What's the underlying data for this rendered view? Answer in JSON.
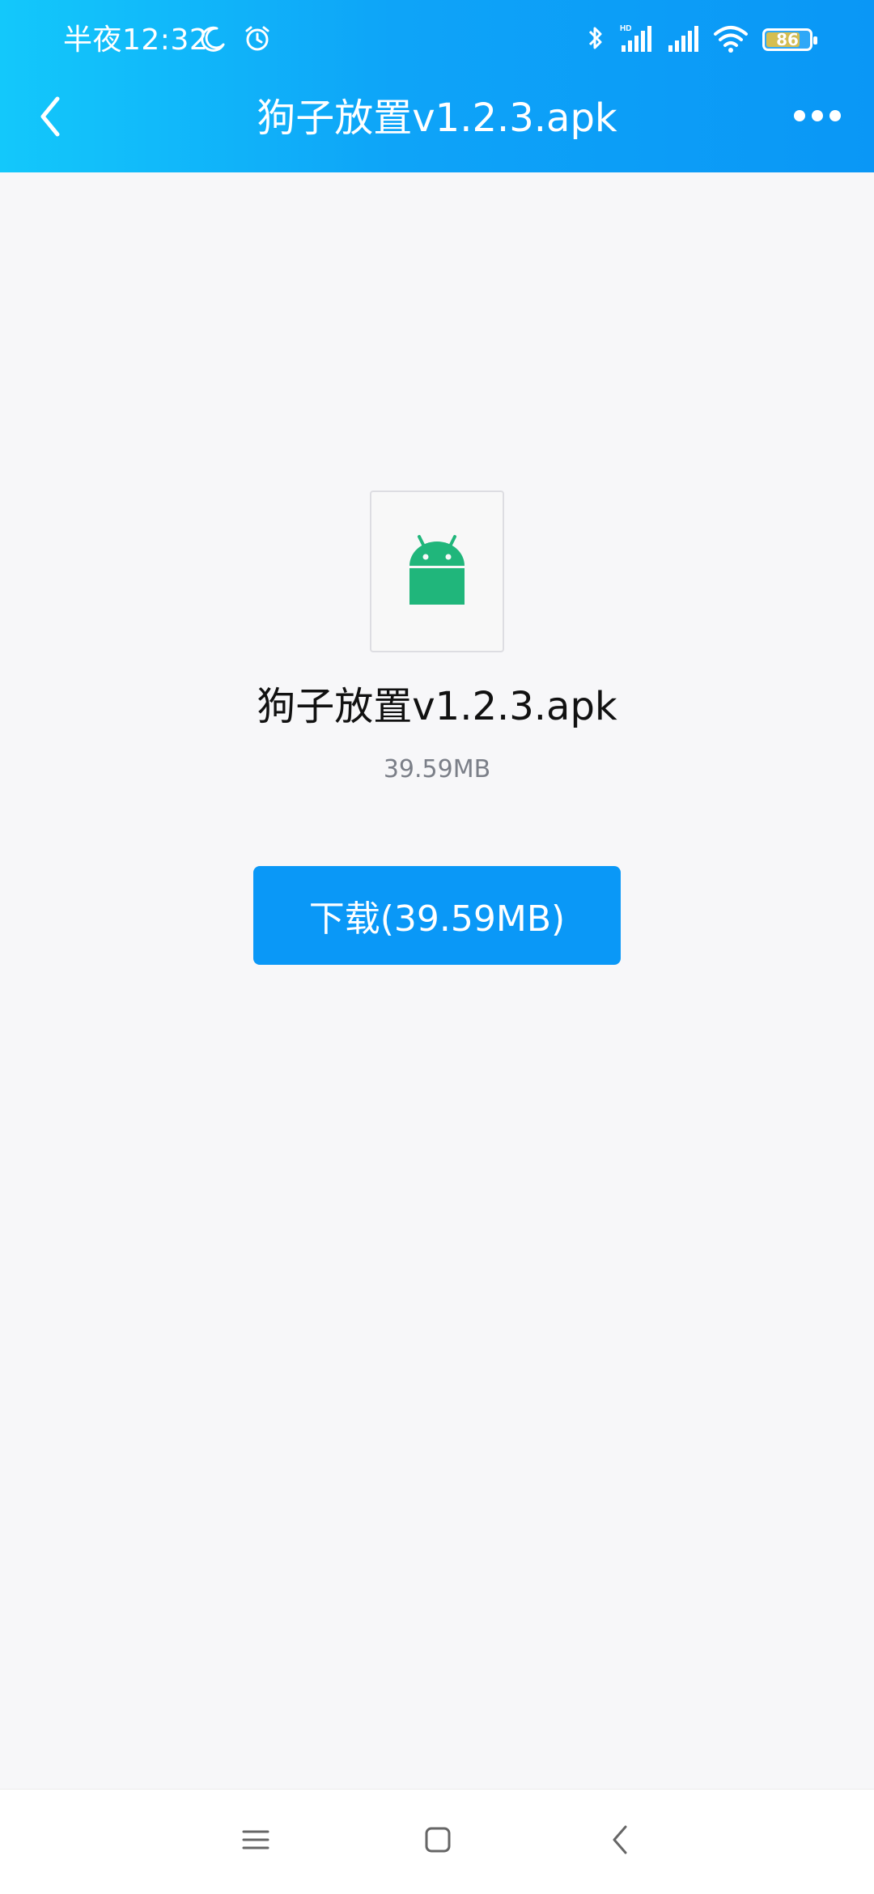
{
  "status_bar": {
    "time": "半夜12:32",
    "battery": "86",
    "icons": [
      "moon-icon",
      "alarm-icon",
      "bluetooth-icon",
      "hd-signal-icon",
      "signal-icon",
      "wifi-icon",
      "battery-icon"
    ]
  },
  "header": {
    "title": "狗子放置v1.2.3.apk",
    "back_icon": "chevron-left-icon",
    "more_icon": "more-icon"
  },
  "file": {
    "name": "狗子放置v1.2.3.apk",
    "size": "39.59MB",
    "icon": "android-icon"
  },
  "actions": {
    "download_label": "下载(39.59MB)"
  },
  "system_nav": {
    "icons": [
      "menu-icon",
      "home-icon",
      "back-icon"
    ]
  },
  "colors": {
    "header_start": "#13c8fb",
    "header_end": "#0a97f6",
    "button": "#0a98f7",
    "android_green": "#20b67b",
    "background": "#f7f7f9"
  }
}
